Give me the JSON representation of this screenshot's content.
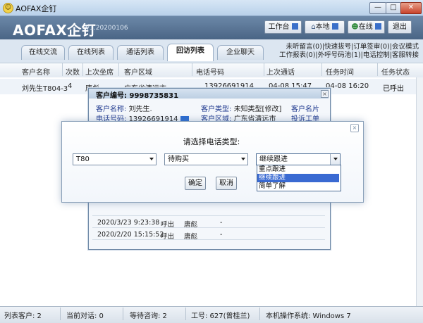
{
  "window": {
    "title": "AOFAX企钉",
    "logo_glyph": "☺",
    "min": "—",
    "max": "□",
    "close": "✕"
  },
  "header": {
    "logo": "AOFAX企钉",
    "version": "V1.20200106",
    "buttons": [
      {
        "label": "工作台",
        "icon": "dropdown-arrow"
      },
      {
        "label": "本地",
        "icon": "home-icon"
      },
      {
        "label": "在线",
        "icon": "user-online-icon"
      },
      {
        "label": "退出",
        "icon": ""
      }
    ]
  },
  "tabs": [
    "在线交流",
    "在线列表",
    "通话列表",
    "回访列表",
    "企业聊天"
  ],
  "active_tab": "回访列表",
  "notices": [
    "未听留言(0)|快速拔号|订单签审(0)|会议模式",
    "工作报表(0)|外呼号码池(1)|电话控制|客服转接"
  ],
  "table": {
    "columns": [
      "客户名称",
      "次数",
      "上次坐席",
      "客户区域",
      "电话号码",
      "上次通话",
      "任务时间",
      "任务状态"
    ],
    "rows": [
      [
        "刘先生T804-3",
        "4",
        "唐彪",
        "广东省清远市",
        "13926691914",
        "04-08 15:47",
        "04-08 16:20",
        "已呼出"
      ]
    ]
  },
  "customer_window": {
    "title": "客户编号: 9998735831",
    "close": "×",
    "fields": {
      "name_label": "客户名称:",
      "name_value": "刘先生.",
      "type_label": "客户类型:",
      "type_value": "未知类型[修改]",
      "card_label": "客户名片",
      "phone_label": "电话号码:",
      "phone_value": "13926691914",
      "region_label": "客户区域:",
      "region_value": "广东省清远市",
      "complaint_label": "投诉工单"
    },
    "history": [
      [
        "2020/3/23 9:23:38",
        "呼出",
        "唐彪",
        "-"
      ],
      [
        "2020/2/20 15:15:52",
        "呼出",
        "唐彪",
        "-"
      ]
    ]
  },
  "dialog": {
    "title": "请选择电话类型:",
    "close": "×",
    "select1": "T80",
    "select2": "待购买",
    "select3": "继续跟进",
    "options": [
      "重点跟进",
      "继续跟进",
      "简单了解"
    ],
    "highlighted_option": "继续跟进",
    "ok": "确定",
    "cancel": "取消"
  },
  "status_bar": {
    "list_customers": "列表客户: 2",
    "current_calls": "当前对话: 0",
    "waiting": "等待咨询: 2",
    "employee": "工号: 627(曾桂兰)",
    "os": "本机操作系统: Windows 7"
  },
  "colors": {
    "header": "#5a7596",
    "highlight": "#3a6ad2",
    "link": "#203a8f"
  }
}
